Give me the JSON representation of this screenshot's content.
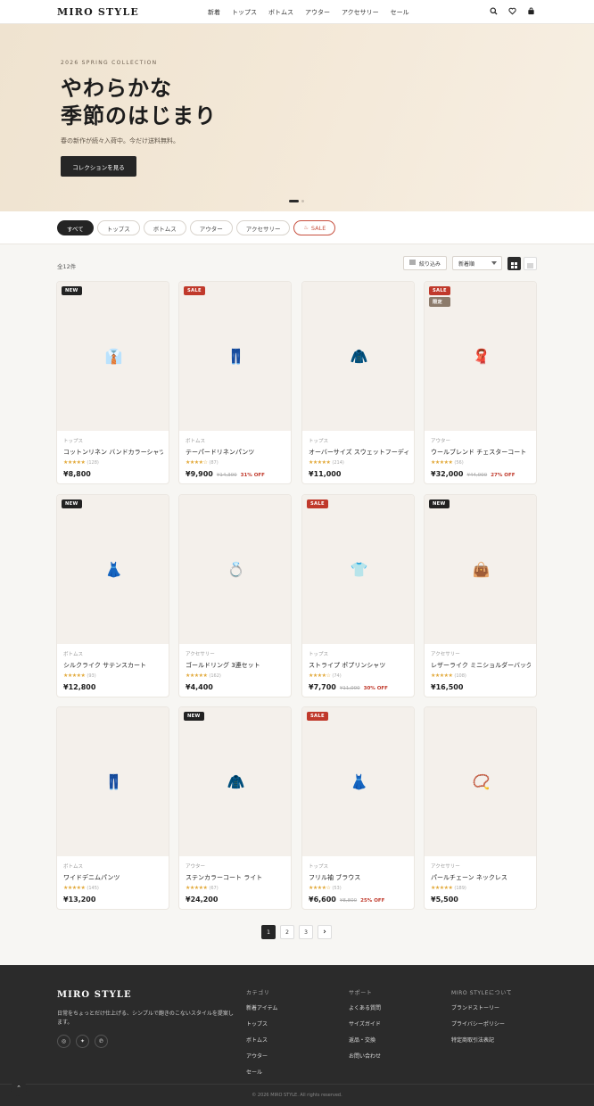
{
  "header": {
    "logo": "MIRO STYLE",
    "nav": [
      "新着",
      "トップス",
      "ボトムス",
      "アウター",
      "アクセサリー",
      "セール"
    ],
    "icons": [
      "search-icon",
      "heart-icon",
      "bag-icon"
    ]
  },
  "hero": {
    "kicker": "2026 SPRING COLLECTION",
    "title_line1": "やわらかな",
    "title_line2": "季節のはじまり",
    "subtitle": "春の新作が続々入荷中。今だけ送料無料。",
    "button": "コレクションを見る",
    "slide": 1,
    "slide_total": 2
  },
  "filters": {
    "chips": [
      "すべて",
      "トップス",
      "ボトムス",
      "アウター",
      "アクセサリー",
      "SALE"
    ],
    "active": "すべて",
    "sale_icon": "fire-icon"
  },
  "toolbar": {
    "count": "全12件",
    "filter_label": "絞り込み",
    "sort_label": "新着順"
  },
  "products": [
    {
      "category": "トップス",
      "name": "コットンリネン バンドカラーシャツ",
      "stars": "★★★★★",
      "reviews": "(128)",
      "price": "¥8,800",
      "original": "",
      "discount": "",
      "badges": [
        "NEW"
      ],
      "glyph": "👔"
    },
    {
      "category": "ボトムス",
      "name": "テーパードリネンパンツ",
      "stars": "★★★★☆",
      "reviews": "(87)",
      "price": "¥9,900",
      "original": "¥14,300",
      "discount": "31% OFF",
      "badges": [
        "SALE"
      ],
      "glyph": "👖"
    },
    {
      "category": "トップス",
      "name": "オーバーサイズ スウェットフーディ",
      "stars": "★★★★★",
      "reviews": "(214)",
      "price": "¥11,000",
      "original": "",
      "discount": "",
      "badges": [],
      "glyph": "🧥"
    },
    {
      "category": "アウター",
      "name": "ウールブレンド チェスターコート",
      "stars": "★★★★★",
      "reviews": "(56)",
      "price": "¥32,000",
      "original": "¥44,000",
      "discount": "27% OFF",
      "badges": [
        "SALE",
        "限定"
      ],
      "glyph": "🧣"
    },
    {
      "category": "ボトムス",
      "name": "シルクライク サテンスカート",
      "stars": "★★★★★",
      "reviews": "(93)",
      "price": "¥12,800",
      "original": "",
      "discount": "",
      "badges": [
        "NEW"
      ],
      "glyph": "👗"
    },
    {
      "category": "アクセサリー",
      "name": "ゴールドリング 3連セット",
      "stars": "★★★★★",
      "reviews": "(162)",
      "price": "¥4,400",
      "original": "",
      "discount": "",
      "badges": [],
      "glyph": "💍"
    },
    {
      "category": "トップス",
      "name": "ストライプ ポプリンシャツ",
      "stars": "★★★★☆",
      "reviews": "(74)",
      "price": "¥7,700",
      "original": "¥11,000",
      "discount": "30% OFF",
      "badges": [
        "SALE"
      ],
      "glyph": "👕"
    },
    {
      "category": "アクセサリー",
      "name": "レザーライク ミニショルダーバッグ",
      "stars": "★★★★★",
      "reviews": "(108)",
      "price": "¥16,500",
      "original": "",
      "discount": "",
      "badges": [
        "NEW"
      ],
      "glyph": "👜"
    },
    {
      "category": "ボトムス",
      "name": "ワイドデニムパンツ",
      "stars": "★★★★★",
      "reviews": "(145)",
      "price": "¥13,200",
      "original": "",
      "discount": "",
      "badges": [],
      "glyph": "👖"
    },
    {
      "category": "アウター",
      "name": "ステンカラーコート ライト",
      "stars": "★★★★★",
      "reviews": "(67)",
      "price": "¥24,200",
      "original": "",
      "discount": "",
      "badges": [
        "NEW"
      ],
      "glyph": "🧥"
    },
    {
      "category": "トップス",
      "name": "フリル袖 ブラウス",
      "stars": "★★★★☆",
      "reviews": "(53)",
      "price": "¥6,600",
      "original": "¥8,800",
      "discount": "25% OFF",
      "badges": [
        "SALE"
      ],
      "glyph": "👗"
    },
    {
      "category": "アクセサリー",
      "name": "パールチェーン ネックレス",
      "stars": "★★★★★",
      "reviews": "(189)",
      "price": "¥5,500",
      "original": "",
      "discount": "",
      "badges": [],
      "glyph": "📿"
    }
  ],
  "pagination": {
    "pages": [
      "1",
      "2",
      "3"
    ],
    "current": "1",
    "next": "›"
  },
  "footer": {
    "logo": "MIRO STYLE",
    "description": "日常をちょっとだけ仕上げる、シンプルで飽きのこないスタイルを提案します。",
    "social": [
      "instagram-icon",
      "twitter-icon",
      "pinterest-icon"
    ],
    "columns": [
      {
        "heading": "カテゴリ",
        "links": [
          "新着アイテム",
          "トップス",
          "ボトムス",
          "アウター",
          "セール"
        ]
      },
      {
        "heading": "サポート",
        "links": [
          "よくある質問",
          "サイズガイド",
          "返品・交換",
          "お問い合わせ"
        ]
      },
      {
        "heading": "MIRO STYLEについて",
        "links": [
          "ブランドストーリー",
          "プライバシーポリシー",
          "特定商取引法表記"
        ]
      }
    ],
    "copyright": "© 2026 MIRO STYLE. All rights reserved."
  },
  "colors": {
    "accent": "#c0392b",
    "dark": "#262626",
    "hero_bg": "#efe3d0",
    "star": "#e2a93a"
  }
}
